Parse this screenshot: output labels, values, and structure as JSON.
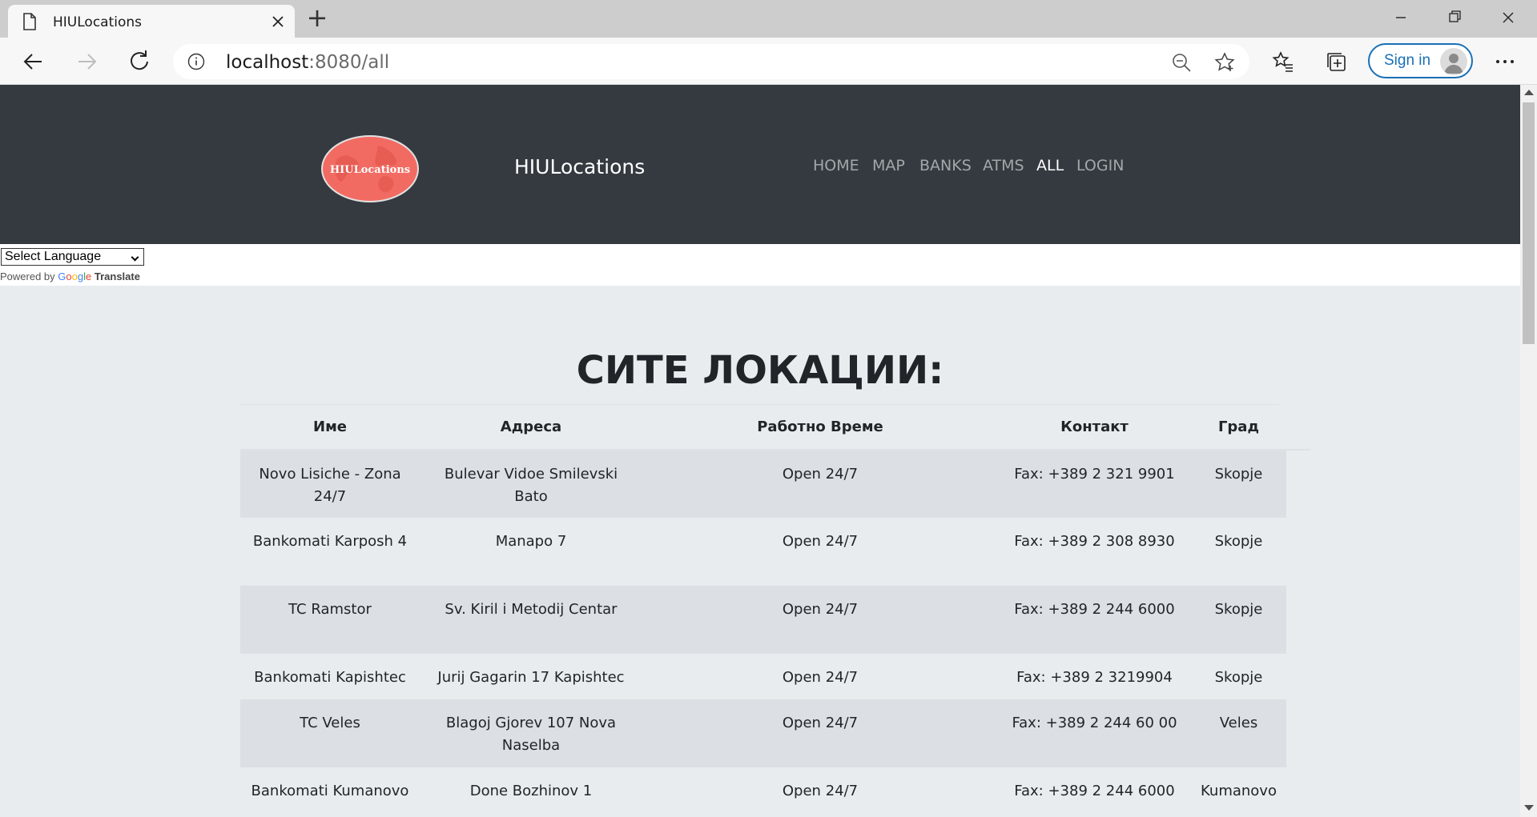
{
  "browser": {
    "tab_title": "HIULocations",
    "new_tab_symbol": "+",
    "url_host": "localhost",
    "url_path": ":8080/all",
    "sign_in_label": "Sign in",
    "icons": [
      "page-icon",
      "close-icon",
      "back-icon",
      "forward-icon",
      "reload-icon",
      "info-icon",
      "zoom-out-icon",
      "star-icon",
      "favorites-icon",
      "collections-icon",
      "more-icon"
    ]
  },
  "site": {
    "logo_text": "HIULocations",
    "brand": "HIULocations",
    "nav": {
      "home": "HOME",
      "map": "MAP",
      "banks": "BANKS",
      "atms": "ATMS",
      "all": "ALL",
      "login": "LOGIN"
    },
    "active_nav": "ALL",
    "header_color": "#343a40",
    "logo_color": "#f26b63"
  },
  "translate": {
    "select_value": "Select Language",
    "powered_by": "Powered by",
    "google": [
      "G",
      "o",
      "o",
      "g",
      "l",
      "e"
    ],
    "translate_label": "Translate"
  },
  "main": {
    "heading": "СИТЕ ЛОКАЦИИ:",
    "columns": [
      "Име",
      "Адреса",
      "Работно Време",
      "Контакт",
      "Град"
    ],
    "rows": [
      {
        "name": "Novo Lisiche - Zona 24/7",
        "address": "Bulevar Vidoe Smilevski Bato",
        "hours": "Open 24/7",
        "contact": "Fax: +389 2 321 9901",
        "city": "Skopje"
      },
      {
        "name": "Bankomati Karposh 4",
        "address": "Manapo 7",
        "hours": "Open 24/7",
        "contact": "Fax: +389 2 308 8930",
        "city": "Skopje"
      },
      {
        "name": "TC Ramstor",
        "address": "Sv. Kiril i Metodij Centar",
        "hours": "Open 24/7",
        "contact": "Fax: +389 2 244 6000",
        "city": "Skopje"
      },
      {
        "name": "Bankomati Kapishtec",
        "address": "Jurij Gagarin 17 Kapishtec",
        "hours": "Open 24/7",
        "contact": "Fax: +389 2 3219904",
        "city": "Skopje"
      },
      {
        "name": "TC Veles",
        "address": "Blagoj Gjorev 107 Nova Naselba",
        "hours": "Open 24/7",
        "contact": "Fax: +389 2 244 60 00",
        "city": "Veles"
      },
      {
        "name": "Bankomati Kumanovo",
        "address": "Done Bozhinov 1",
        "hours": "Open 24/7",
        "contact": "Fax: +389 2 244 6000",
        "city": "Kumanovo"
      }
    ]
  }
}
